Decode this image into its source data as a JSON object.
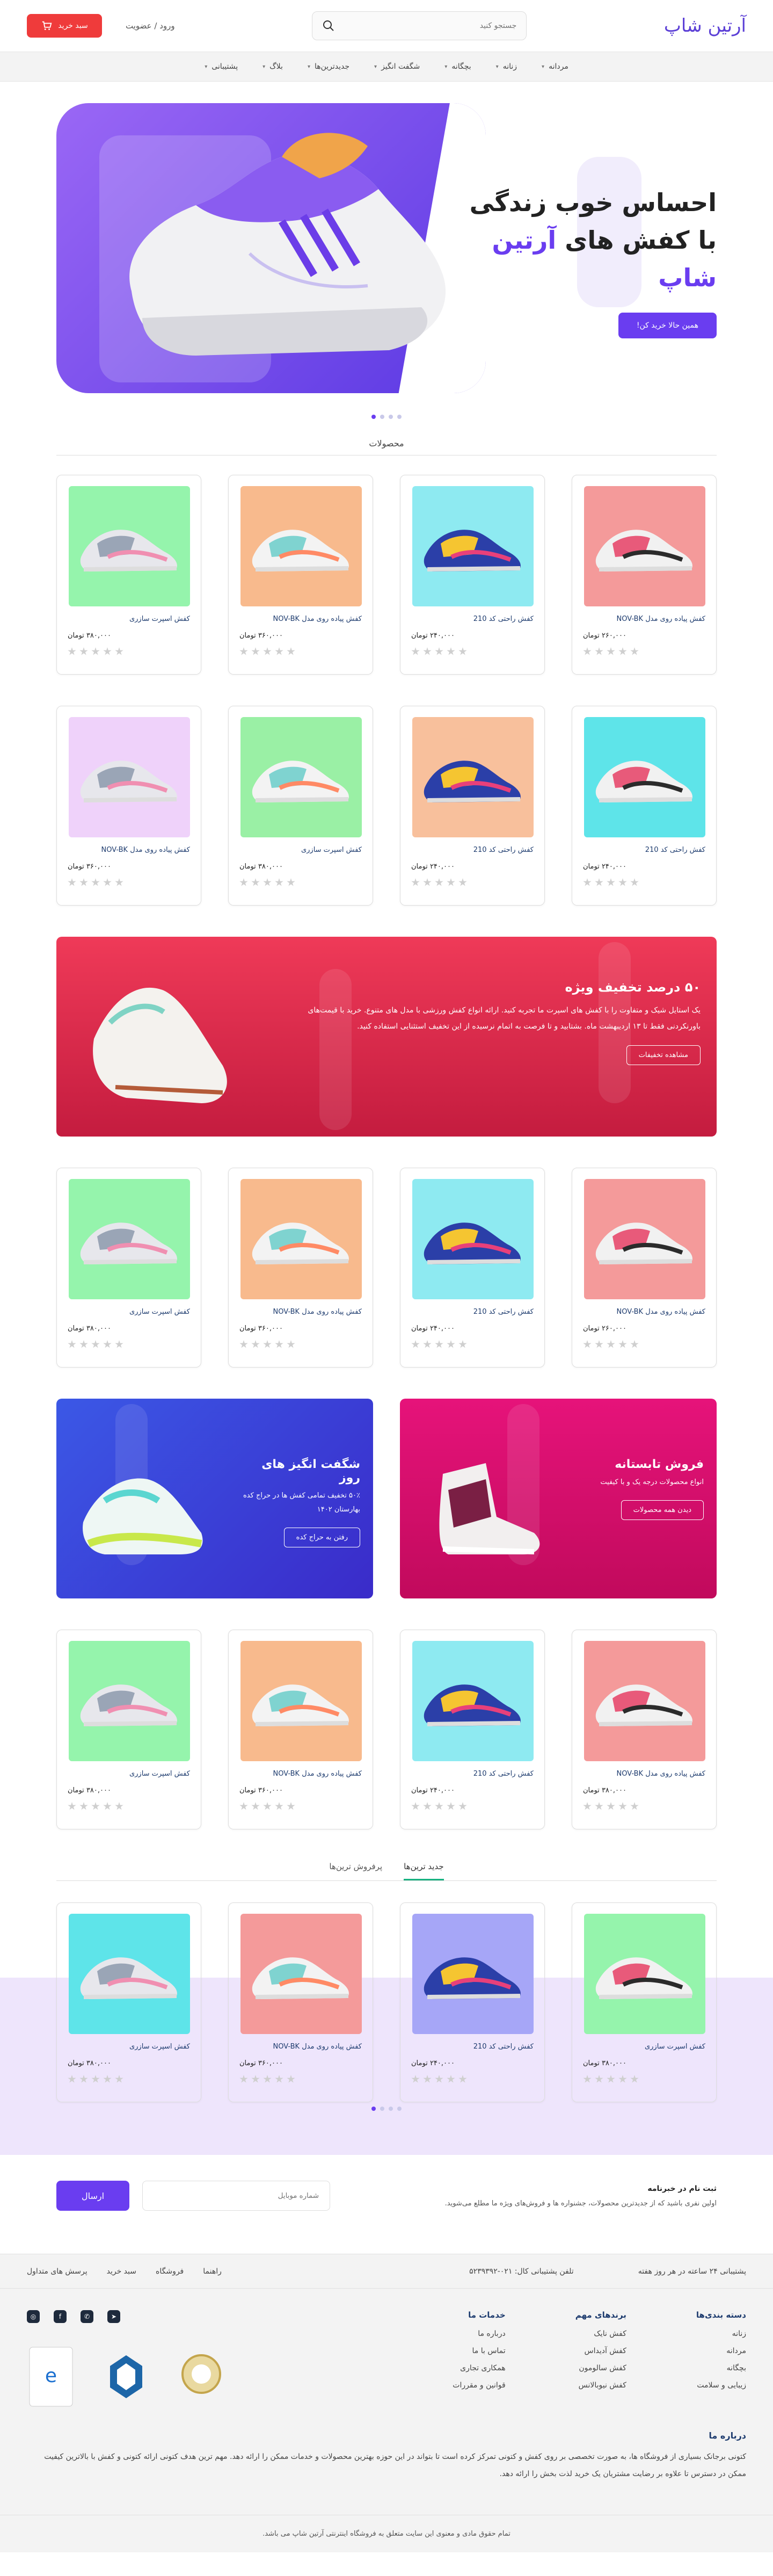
{
  "header": {
    "logo": "آرتین شاپ",
    "search_placeholder": "جستجو کنید",
    "login": "ورود / عضویت",
    "cart": "سبد خرید"
  },
  "nav": [
    {
      "label": "مردانه",
      "dropdown": true
    },
    {
      "label": "زنانه",
      "dropdown": true
    },
    {
      "label": "بچگانه",
      "dropdown": true
    },
    {
      "label": "شگفت انگیز",
      "dropdown": true
    },
    {
      "label": "جدیدترین‌ها",
      "dropdown": true
    },
    {
      "label": "بلاگ",
      "dropdown": true
    },
    {
      "label": "پشتیبانی",
      "dropdown": true
    }
  ],
  "hero": {
    "line1": "احساس خوب زندگی",
    "line2_prefix": "با کفش های ",
    "line2_accent": "آرتین شاپ",
    "button": "همین حالا خرید کن!"
  },
  "section_products": "محصولات",
  "products_row1": [
    {
      "name": "کفش پیاده روی مدل NOV-BK",
      "price": "۲۶۰,۰۰۰ تومان",
      "bg": "#f49a9a"
    },
    {
      "name": "کفش راحتی کد 210",
      "price": "۲۴۰,۰۰۰ تومان",
      "bg": "#8eeaf1"
    },
    {
      "name": "کفش پیاده روی مدل NOV-BK",
      "price": "۳۶۰,۰۰۰ تومان",
      "bg": "#f8ba8d"
    },
    {
      "name": "کفش اسپرت سازری",
      "price": "۳۸۰,۰۰۰ تومان",
      "bg": "#95f4ac"
    }
  ],
  "products_row2": [
    {
      "name": "کفش راحتی کد 210",
      "price": "۲۴۰,۰۰۰ تومان",
      "bg": "#5ee4e9"
    },
    {
      "name": "کفش راحتی کد 210",
      "price": "۲۴۰,۰۰۰ تومان",
      "bg": "#f8c09c"
    },
    {
      "name": "کفش اسپرت سازری",
      "price": "۳۸۰,۰۰۰ تومان",
      "bg": "#9af0a5"
    },
    {
      "name": "کفش پیاده روی مدل NOV-BK",
      "price": "۳۶۰,۰۰۰ تومان",
      "bg": "#efd2fa"
    }
  ],
  "promo": {
    "title": "۵۰ درصد تخفیف ویژه",
    "text": "یک استایل شیک و متفاوت را با کفش های اسپرت ما تجربه کنید. ارائه انواع کفش ورزشی با مدل های متنوع. خرید با قیمت‌های باورنکردنی فقط تا ۱۳ اردیبهشت ماه. بشتابید و تا فرصت به اتمام نرسیده از این تخفیف استثنایی استفاده کنید.",
    "button": "مشاهده تخفیفات"
  },
  "products_row3": [
    {
      "name": "کفش پیاده روی مدل NOV-BK",
      "price": "۲۶۰,۰۰۰ تومان",
      "bg": "#f49a9a"
    },
    {
      "name": "کفش راحتی کد 210",
      "price": "۲۴۰,۰۰۰ تومان",
      "bg": "#8eeaf1"
    },
    {
      "name": "کفش پیاده روی مدل NOV-BK",
      "price": "۳۶۰,۰۰۰ تومان",
      "bg": "#f8ba8d"
    },
    {
      "name": "کفش اسپرت سازری",
      "price": "۳۸۰,۰۰۰ تومان",
      "bg": "#95f4ac"
    }
  ],
  "banner_summer": {
    "title": "فروش تابستانه",
    "text": "انواع محصولات درجه یک و با کیفیت",
    "button": "دیدن همه محصولات"
  },
  "banner_amazing": {
    "title": "شگفت انگیز های روز",
    "text": "۵۰٪ تخفیف تمامی کفش ها در حراج کده بهارستان ۱۴۰۲",
    "button": "رفتن به حراج کده"
  },
  "products_row4": [
    {
      "name": "کفش پیاده روی مدل NOV-BK",
      "price": "۳۸۰,۰۰۰ تومان",
      "bg": "#f49a9a"
    },
    {
      "name": "کفش راحتی کد 210",
      "price": "۲۴۰,۰۰۰ تومان",
      "bg": "#8eeaf1"
    },
    {
      "name": "کفش پیاده روی مدل NOV-BK",
      "price": "۳۶۰,۰۰۰ تومان",
      "bg": "#f8ba8d"
    },
    {
      "name": "کفش اسپرت سازری",
      "price": "۳۸۰,۰۰۰ تومان",
      "bg": "#95f4ac"
    }
  ],
  "tabs": {
    "newest": "جدید ترین‌ها",
    "best": "پرفروش ترین‌ها"
  },
  "products_row5": [
    {
      "name": "کفش اسپرت سازری",
      "price": "۳۸۰,۰۰۰ تومان",
      "bg": "#95f4ac"
    },
    {
      "name": "کفش راحتی کد 210",
      "price": "۲۴۰,۰۰۰ تومان",
      "bg": "#a6a6f7"
    },
    {
      "name": "کفش پیاده روی مدل NOV-BK",
      "price": "۳۶۰,۰۰۰ تومان",
      "bg": "#f49a9a"
    },
    {
      "name": "کفش اسپرت سازری",
      "price": "۳۸۰,۰۰۰ تومان",
      "bg": "#5ee4e9"
    }
  ],
  "newsletter": {
    "title": "ثبت نام در خبرنامه",
    "text": "اولین نفری باشید که از جدیدترین محصولات، جشنواره ها و فروش‌های ویژه ما مطلع می‌شوید.",
    "placeholder": "شماره موبایل",
    "button": "ارسال"
  },
  "footer_top": {
    "support": "پشتیبانی ۲۴ ساعته در هر روز هفته",
    "phone": "تلفن پشتیبانی کال: ۰۲۱-۵۲۳۹۳۹۲",
    "links": [
      "راهنما",
      "فروشگاه",
      "سبد خرید",
      "پرسش های متداول"
    ]
  },
  "footer_cols": [
    {
      "title": "دسته بندی‌ها",
      "items": [
        "زنانه",
        "مردانه",
        "بچگانه",
        "زیبایی و سلامت"
      ]
    },
    {
      "title": "برندهای مهم",
      "items": [
        "کفش نایک",
        "کفش آدیداس",
        "کفش سالومون",
        "کفش نیوبالانس"
      ]
    },
    {
      "title": "خدمات ما",
      "items": [
        "درباره ما",
        "تماس با ما",
        "همکاری تجاری",
        "قوانین و مقررات"
      ]
    }
  ],
  "about": {
    "title": "درباره ما",
    "text": "کتونی برجانک بسیاری از فروشگاه ها، به صورت تخصصی بر روی کفش و کتونی تمرکز کرده است تا بتواند در این حوزه بهترین محصولات و خدمات ممکن را ارائه دهد. مهم ترین هدف کتونی ارائه کتونی و کفش با بالاترین کیفیت ممکن در دسترس تا علاوه بر رضایت مشتریان یک خرید لذت بخش را ارائه دهد."
  },
  "copyright": "تمام حقوق مادی و معنوی این سایت متعلق به فروشگاه اینترنتی آرتین شاپ می باشد.",
  "colors": {
    "primary": "#6a3df0",
    "red": "#ef3b3b",
    "green": "#18b281"
  }
}
